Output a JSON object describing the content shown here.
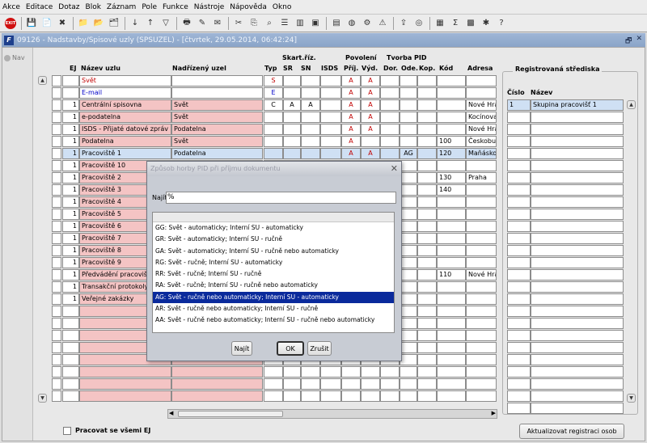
{
  "menu": [
    "Akce",
    "Editace",
    "Dotaz",
    "Blok",
    "Záznam",
    "Pole",
    "Funkce",
    "Nástroje",
    "Nápověda",
    "Okno"
  ],
  "toolbar": {
    "exit_label": "EXIT",
    "icons": [
      "save-icon",
      "save-new-icon",
      "delete-icon",
      "folder-icon",
      "folder-add-icon",
      "folder-remove-icon",
      "sort-asc-icon",
      "sort-desc-icon",
      "filter-icon",
      "print-icon",
      "edit-icon",
      "mail-icon",
      "cut-icon",
      "attach-icon",
      "scan-icon",
      "list-icon",
      "columns-icon",
      "stamp-icon",
      "document-icon",
      "globe-icon",
      "gear-icon",
      "warning-icon",
      "export-icon",
      "disk-icon",
      "chart-icon",
      "sum-icon",
      "grid-icon",
      "settings-icon",
      "help-icon"
    ]
  },
  "window": {
    "title": "09126 - Nadstavby/Spisové uzly (SPSUZEL) - [čtvrtek, 29.05.2014, 06:42:24]",
    "app_icon": "F"
  },
  "nav": {
    "label": "Nav"
  },
  "table": {
    "group_headers": {
      "skart": "Skart.říz.",
      "povoleni": "Povolení",
      "tvorba": "Tvorba PID"
    },
    "headers": {
      "ej": "EJ",
      "nazev": "Název uzlu",
      "nadrizeny": "Nadřízený uzel",
      "typ": "Typ",
      "sr": "SR",
      "sn": "SN",
      "isds": "ISDS",
      "prij": "Příj.",
      "vyd": "Výd.",
      "dor": "Dor.",
      "ode": "Ode.",
      "kop": "Kop.",
      "kod": "Kód",
      "adresa": "Adresa"
    },
    "rows": [
      {
        "ej": "",
        "nazev": "Svět",
        "nadrizeny": "",
        "typ": "S",
        "sr": "",
        "sn": "",
        "prij": "A",
        "vyd": "A",
        "ode": "",
        "kod": "",
        "adresa": ""
      },
      {
        "ej": "",
        "nazev": "E-mail",
        "nadrizeny": "",
        "typ": "E",
        "sr": "",
        "sn": "",
        "prij": "A",
        "vyd": "A",
        "ode": "",
        "kod": "",
        "adresa": ""
      },
      {
        "ej": "1",
        "nazev": "Centrální spisovna",
        "nadrizeny": "Svět",
        "typ": "C",
        "sr": "A",
        "sn": "A",
        "prij": "A",
        "vyd": "A",
        "ode": "",
        "kod": "",
        "adresa": "Nové Hra"
      },
      {
        "ej": "1",
        "nazev": "e-podatelna",
        "nadrizeny": "Svět",
        "typ": "",
        "sr": "",
        "sn": "",
        "prij": "A",
        "vyd": "A",
        "ode": "",
        "kod": "",
        "adresa": "Kocínova"
      },
      {
        "ej": "1",
        "nazev": "ISDS - Přijaté datové zpráv",
        "nadrizeny": "Podatelna",
        "typ": "",
        "sr": "",
        "sn": "",
        "prij": "A",
        "vyd": "A",
        "ode": "",
        "kod": "",
        "adresa": "Nové Hra"
      },
      {
        "ej": "1",
        "nazev": "Podatelna",
        "nadrizeny": "Svět",
        "typ": "",
        "sr": "",
        "sn": "",
        "prij": "A",
        "vyd": "",
        "ode": "",
        "kod": "100",
        "adresa": "Českobu"
      },
      {
        "ej": "1",
        "nazev": "Pracoviště 1",
        "nadrizeny": "Podatelna",
        "typ": "",
        "sr": "",
        "sn": "",
        "prij": "A",
        "vyd": "A",
        "ode": "AG",
        "kod": "120",
        "adresa": "Maňásko"
      },
      {
        "ej": "1",
        "nazev": "Pracoviště 10",
        "nadrizeny": "",
        "typ": "",
        "sr": "",
        "sn": "",
        "prij": "",
        "vyd": "",
        "ode": "",
        "kod": "",
        "adresa": ""
      },
      {
        "ej": "1",
        "nazev": "Pracoviště 2",
        "nadrizeny": "",
        "typ": "",
        "sr": "",
        "sn": "",
        "prij": "",
        "vyd": "",
        "ode": "",
        "kod": "130",
        "adresa": "Praha"
      },
      {
        "ej": "1",
        "nazev": "Pracoviště 3",
        "nadrizeny": "",
        "typ": "",
        "sr": "",
        "sn": "",
        "prij": "",
        "vyd": "",
        "ode": "",
        "kod": "140",
        "adresa": ""
      },
      {
        "ej": "1",
        "nazev": "Pracoviště 4",
        "nadrizeny": "",
        "typ": "",
        "sr": "",
        "sn": "",
        "prij": "",
        "vyd": "",
        "ode": "",
        "kod": "",
        "adresa": ""
      },
      {
        "ej": "1",
        "nazev": "Pracoviště 5",
        "nadrizeny": "",
        "typ": "",
        "sr": "",
        "sn": "",
        "prij": "",
        "vyd": "",
        "ode": "",
        "kod": "",
        "adresa": ""
      },
      {
        "ej": "1",
        "nazev": "Pracoviště 6",
        "nadrizeny": "",
        "typ": "",
        "sr": "",
        "sn": "",
        "prij": "",
        "vyd": "",
        "ode": "",
        "kod": "",
        "adresa": ""
      },
      {
        "ej": "1",
        "nazev": "Pracoviště 7",
        "nadrizeny": "",
        "typ": "",
        "sr": "",
        "sn": "",
        "prij": "",
        "vyd": "",
        "ode": "",
        "kod": "",
        "adresa": ""
      },
      {
        "ej": "1",
        "nazev": "Pracoviště 8",
        "nadrizeny": "",
        "typ": "",
        "sr": "",
        "sn": "",
        "prij": "",
        "vyd": "",
        "ode": "",
        "kod": "",
        "adresa": ""
      },
      {
        "ej": "1",
        "nazev": "Pracoviště 9",
        "nadrizeny": "",
        "typ": "",
        "sr": "",
        "sn": "",
        "prij": "",
        "vyd": "",
        "ode": "",
        "kod": "",
        "adresa": ""
      },
      {
        "ej": "1",
        "nazev": "Předvádění pracoviště",
        "nadrizeny": "",
        "typ": "",
        "sr": "",
        "sn": "",
        "prij": "",
        "vyd": "",
        "ode": "",
        "kod": "110",
        "adresa": "Nové Hra"
      },
      {
        "ej": "1",
        "nazev": "Transakční protokoly",
        "nadrizeny": "",
        "typ": "",
        "sr": "",
        "sn": "",
        "prij": "",
        "vyd": "",
        "ode": "",
        "kod": "",
        "adresa": ""
      },
      {
        "ej": "1",
        "nazev": "Veřejné zakázky",
        "nadrizeny": "",
        "typ": "",
        "sr": "",
        "sn": "",
        "prij": "",
        "vyd": "",
        "ode": "",
        "kod": "",
        "adresa": ""
      }
    ],
    "empty_rows": 8,
    "selected_row": 6
  },
  "right_panel": {
    "title": "Registrovaná střediska",
    "headers": {
      "cislo": "Číslo",
      "nazev": "Název"
    },
    "rows": [
      {
        "cislo": "1",
        "nazev": "Skupina pracovišť 1"
      }
    ],
    "total_rows": 26,
    "button": "Aktualizovat registraci osob"
  },
  "footer": {
    "checkbox_label": "Pracovat se všemi EJ",
    "checked": false
  },
  "dialog": {
    "title": "Způsob horby PID při příjmu dokumentu",
    "search_label": "Najít",
    "search_value": "%",
    "items": [
      "GG: Svět - automaticky; Interní SU - automaticky",
      "GR: Svět - automaticky; Interní SU - ručně",
      "GA: Svět - automaticky; Interní SU - ručně nebo automaticky",
      "RG: Svět - ručně; Interní SU - automaticky",
      "RR: Svět - ručně; Interní SU - ručně",
      "RA: Svět - ručně; Interní SU - ručně nebo automaticky",
      "AG: Svět - ručně nebo automaticky; Interní SU - automaticky",
      "AR: Svět - ručně nebo automaticky; Interní SU - ručně",
      "AA: Svět - ručně nebo automaticky; Interní SU - ručně nebo automaticky"
    ],
    "selected_index": 6,
    "buttons": {
      "find": "Najít",
      "ok": "OK",
      "cancel": "Zrušit"
    }
  }
}
